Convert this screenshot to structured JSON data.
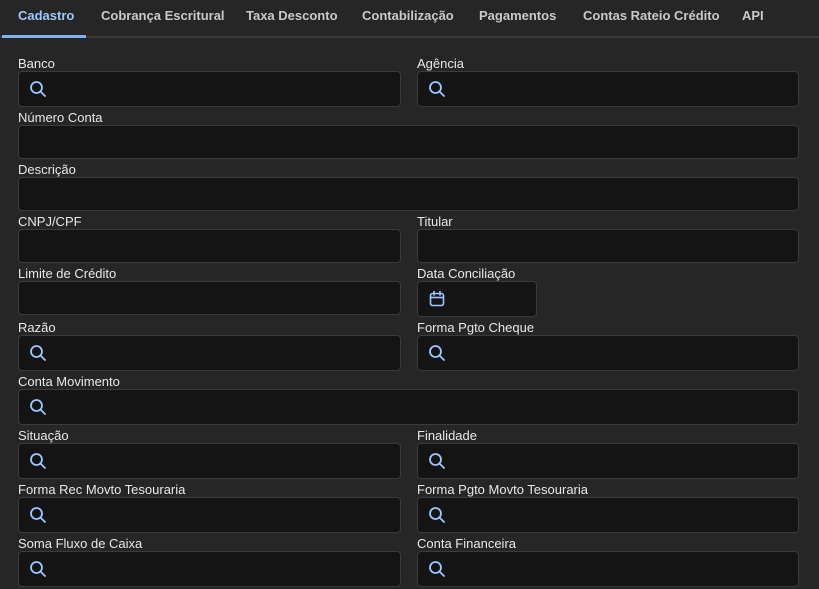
{
  "tabs": [
    {
      "label": "Cadastro",
      "active": true
    },
    {
      "label": "Cobrança Escritural",
      "active": false
    },
    {
      "label": "Taxa Desconto",
      "active": false
    },
    {
      "label": "Contabilização",
      "active": false
    },
    {
      "label": "Pagamentos",
      "active": false
    },
    {
      "label": "Contas Rateio Crédito",
      "active": false
    },
    {
      "label": "API",
      "active": false
    }
  ],
  "form": {
    "banco": {
      "label": "Banco",
      "value": "",
      "icon": "search-icon"
    },
    "agencia": {
      "label": "Agência",
      "value": "",
      "icon": "search-icon"
    },
    "numero_conta": {
      "label": "Número Conta",
      "value": ""
    },
    "descricao": {
      "label": "Descrição",
      "value": ""
    },
    "cnpj_cpf": {
      "label": "CNPJ/CPF",
      "value": ""
    },
    "titular": {
      "label": "Titular",
      "value": ""
    },
    "limite_credito": {
      "label": "Limite de Crédito",
      "value": ""
    },
    "data_conciliacao": {
      "label": "Data Conciliação",
      "value": "",
      "icon": "calendar-icon"
    },
    "razao": {
      "label": "Razão",
      "value": "",
      "icon": "search-icon"
    },
    "forma_pgto_cheque": {
      "label": "Forma Pgto Cheque",
      "value": "",
      "icon": "search-icon"
    },
    "conta_movimento": {
      "label": "Conta Movimento",
      "value": "",
      "icon": "search-icon"
    },
    "situacao": {
      "label": "Situação",
      "value": "",
      "icon": "search-icon"
    },
    "finalidade": {
      "label": "Finalidade",
      "value": "",
      "icon": "search-icon"
    },
    "forma_rec_movto_tesouraria": {
      "label": "Forma Rec Movto Tesouraria",
      "value": "",
      "icon": "search-icon"
    },
    "forma_pgto_movto_tesouraria": {
      "label": "Forma Pgto Movto Tesouraria",
      "value": "",
      "icon": "search-icon"
    },
    "soma_fluxo_caixa": {
      "label": "Soma Fluxo de Caixa",
      "value": "",
      "icon": "search-icon"
    },
    "conta_financeira": {
      "label": "Conta Financeira",
      "value": "",
      "icon": "search-icon"
    }
  },
  "colors": {
    "background": "#262626",
    "field_background": "#141414",
    "accent": "#7fb3f5",
    "icon": "#9cc7ff"
  }
}
